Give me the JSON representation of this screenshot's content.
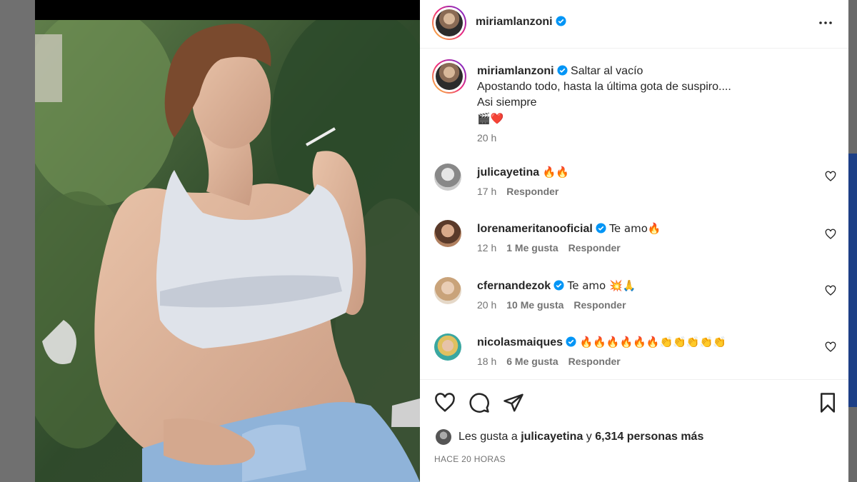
{
  "post": {
    "author": "miriamlanzoni",
    "verified": true
  },
  "caption": {
    "author": "miriamlanzoni",
    "line1": "Saltar al vacío",
    "line2": "Apostando todo, hasta la última gota de suspiro....",
    "line3": "Asi siempre",
    "emojis": "🎬❤️",
    "time": "20 h"
  },
  "comments": [
    {
      "user": "julicayetina",
      "verified": false,
      "text": "🔥🔥",
      "time": "17 h",
      "likes": "",
      "reply": "Responder"
    },
    {
      "user": "lorenameritanooficial",
      "verified": true,
      "text": "Te amo🔥",
      "time": "12 h",
      "likes": "1 Me gusta",
      "reply": "Responder"
    },
    {
      "user": "cfernandezok",
      "verified": true,
      "text": "Te amo 💥🙏",
      "time": "20 h",
      "likes": "10 Me gusta",
      "reply": "Responder"
    },
    {
      "user": "nicolasmaiques",
      "verified": true,
      "text": "🔥🔥🔥🔥🔥🔥👏👏👏👏👏",
      "time": "18 h",
      "likes": "6 Me gusta",
      "reply": "Responder"
    }
  ],
  "likes": {
    "prefix": "Les gusta a",
    "user": "julicayetina",
    "joiner": "y",
    "count": "6,314 personas más"
  },
  "date": "HACE 20 HORAS",
  "colors": {
    "verified": "#0095f6",
    "heart": "#ed4956",
    "text": "#262626",
    "muted": "#737373"
  },
  "icons": [
    "more-icon",
    "heart-icon",
    "comment-icon",
    "share-icon",
    "bookmark-icon",
    "verified-icon"
  ]
}
